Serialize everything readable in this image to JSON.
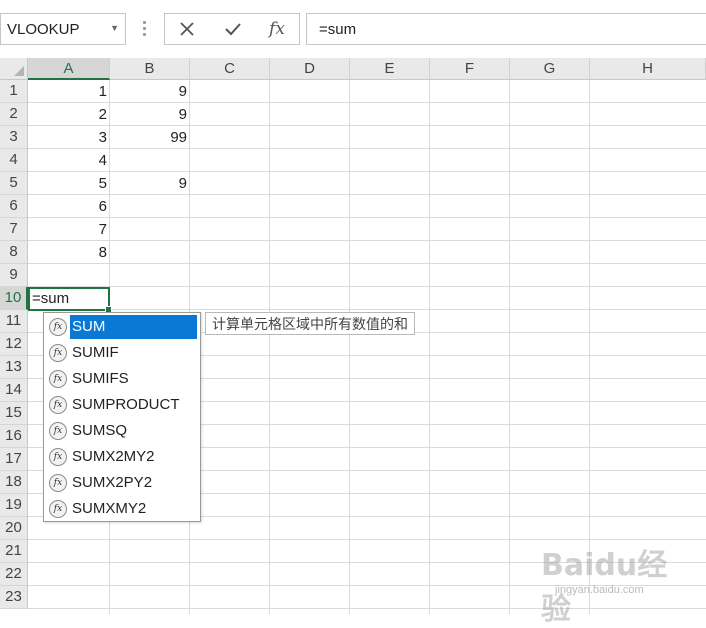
{
  "name_box": {
    "value": "VLOOKUP"
  },
  "formula_bar": {
    "cancel_icon": "close-icon",
    "enter_icon": "checkmark-icon",
    "fx_label": "fx",
    "value": "=sum"
  },
  "columns": [
    "A",
    "B",
    "C",
    "D",
    "E",
    "F",
    "G",
    "H"
  ],
  "rows": [
    "1",
    "2",
    "3",
    "4",
    "5",
    "6",
    "7",
    "8",
    "9",
    "10",
    "11",
    "12",
    "13",
    "14",
    "15",
    "16",
    "17",
    "18",
    "19",
    "20",
    "21",
    "22",
    "23"
  ],
  "cells": {
    "A1": "1",
    "B1": "9",
    "A2": "2",
    "B2": "9",
    "A3": "3",
    "B3": "99",
    "A4": "4",
    "A5": "5",
    "B5": "9",
    "A6": "6",
    "A7": "7",
    "A8": "8"
  },
  "active_cell": {
    "ref": "A10",
    "value": "=sum"
  },
  "autocomplete": {
    "items": [
      "SUM",
      "SUMIF",
      "SUMIFS",
      "SUMPRODUCT",
      "SUMSQ",
      "SUMX2MY2",
      "SUMX2PY2",
      "SUMXMY2"
    ],
    "selected_index": 0,
    "icon": "function-icon",
    "tooltip": "计算单元格区域中所有数值的和"
  },
  "watermark": {
    "text": "Baidu经验",
    "url": "jingyan.baidu.com"
  },
  "colors": {
    "accent_green": "#217346",
    "highlight_blue": "#0a79d6"
  }
}
